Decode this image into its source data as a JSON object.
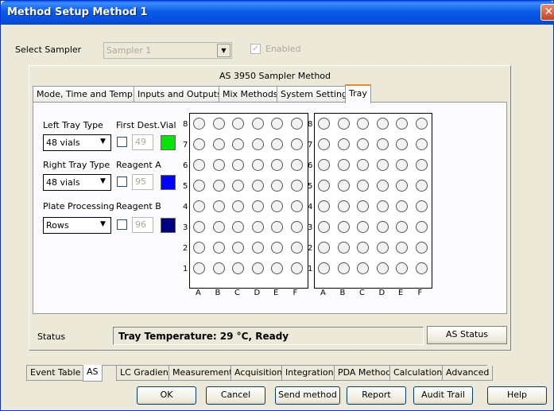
{
  "window": {
    "title": "Method Setup Method 1",
    "close_glyph": "✕"
  },
  "sampler": {
    "label": "Select Sampler",
    "value": "Sampler 1",
    "enabled_label": "Enabled",
    "checked_glyph": "✓"
  },
  "panel_title": "AS 3950 Sampler Method",
  "tabs": [
    {
      "label": "Mode, Time and Temp."
    },
    {
      "label": "Inputs and Outputs"
    },
    {
      "label": "Mix Methods"
    },
    {
      "label": "System Settings"
    },
    {
      "label": "Tray"
    }
  ],
  "active_tab": 4,
  "tray_settings": {
    "left_tray_label": "Left Tray Type",
    "left_tray_value": "48 vials",
    "right_tray_label": "Right Tray Type",
    "right_tray_value": "48 vials",
    "plate_processing_label": "Plate Processing",
    "plate_processing_value": "Rows",
    "first_dest_vial_label": "First Dest.Vial",
    "first_dest_vial_value": "49",
    "first_dest_vial_color": "#00e600",
    "reagent_a_label": "Reagent A",
    "reagent_a_value": "95",
    "reagent_a_color": "#0000ff",
    "reagent_b_label": "Reagent B",
    "reagent_b_value": "96",
    "reagent_b_color": "#000080"
  },
  "grid": {
    "rows": [
      "8",
      "7",
      "6",
      "5",
      "4",
      "3",
      "2",
      "1"
    ],
    "columns": [
      "A",
      "B",
      "C",
      "D",
      "E",
      "F"
    ]
  },
  "status": {
    "label": "Status",
    "text": "Tray Temperature: 29 °C, Ready",
    "button": "AS Status"
  },
  "bottom_tabs": [
    {
      "label": "Event Table"
    },
    {
      "label": "AS"
    },
    {
      "label": "LC Gradient"
    },
    {
      "label": "Measurement"
    },
    {
      "label": "Acquisition"
    },
    {
      "label": "Integration"
    },
    {
      "label": "PDA Method"
    },
    {
      "label": "Calculation"
    },
    {
      "label": "Advanced"
    }
  ],
  "buttons": {
    "ok": "OK",
    "cancel": "Cancel",
    "send_method": "Send method",
    "report": "Report",
    "audit_trail": "Audit Trail",
    "help": "Help"
  },
  "icons": {
    "dropdown": "chevron-down-icon",
    "close": "close-icon"
  }
}
